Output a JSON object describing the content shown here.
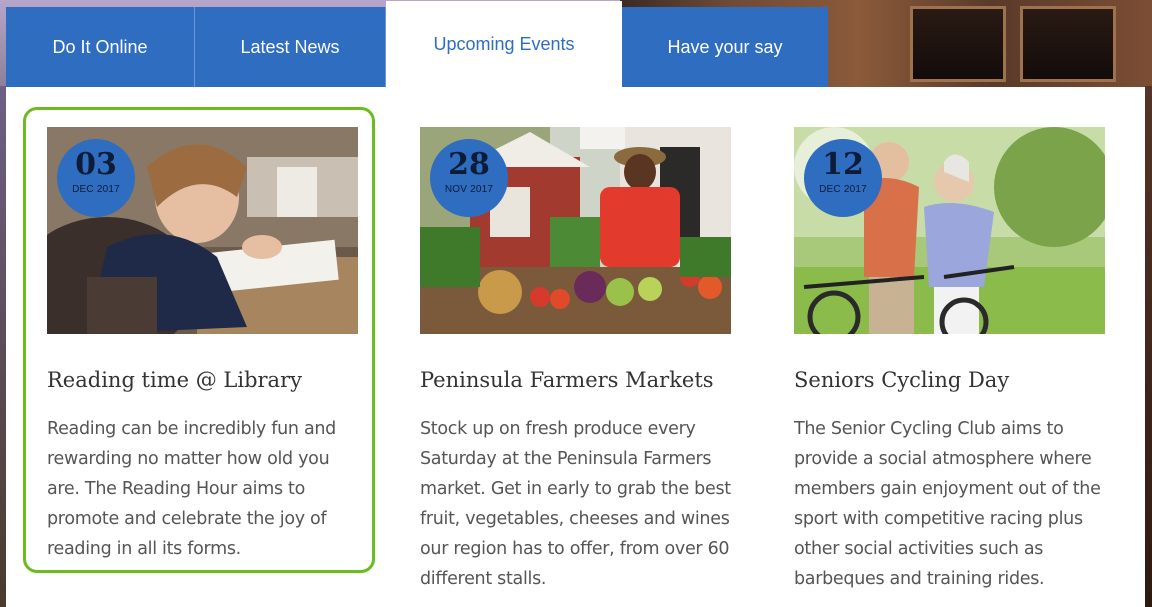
{
  "tabs": [
    {
      "label": "Do It Online"
    },
    {
      "label": "Latest News"
    },
    {
      "label": "Upcoming Events"
    },
    {
      "label": "Have your say"
    }
  ],
  "active_tab": "Upcoming Events",
  "events": [
    {
      "day": "03",
      "month": "DEC 2017",
      "title": "Reading time @ Library",
      "description": "Reading can be incredibly fun and rewarding no matter how old you are. The Reading Hour aims to promote and celebrate the joy of reading in all its forms."
    },
    {
      "day": "28",
      "month": "NOV 2017",
      "title": "Peninsula Farmers Markets",
      "description": "Stock up on fresh produce every Saturday at the Peninsula Farmers market. Get in early to grab the best fruit, vegetables, cheeses and wines our region has to offer, from over 60 different stalls."
    },
    {
      "day": "12",
      "month": "DEC 2017",
      "title": "Seniors Cycling Day",
      "description": "The Senior Cycling Club aims to provide a social atmosphere where members gain enjoyment out of the sport with competitive racing plus other social activities such as barbeques and training rides."
    }
  ],
  "colors": {
    "tab_blue": "#2e6dc0",
    "badge_blue": "#2e6dc0",
    "highlight_green": "#6cbb1f"
  }
}
